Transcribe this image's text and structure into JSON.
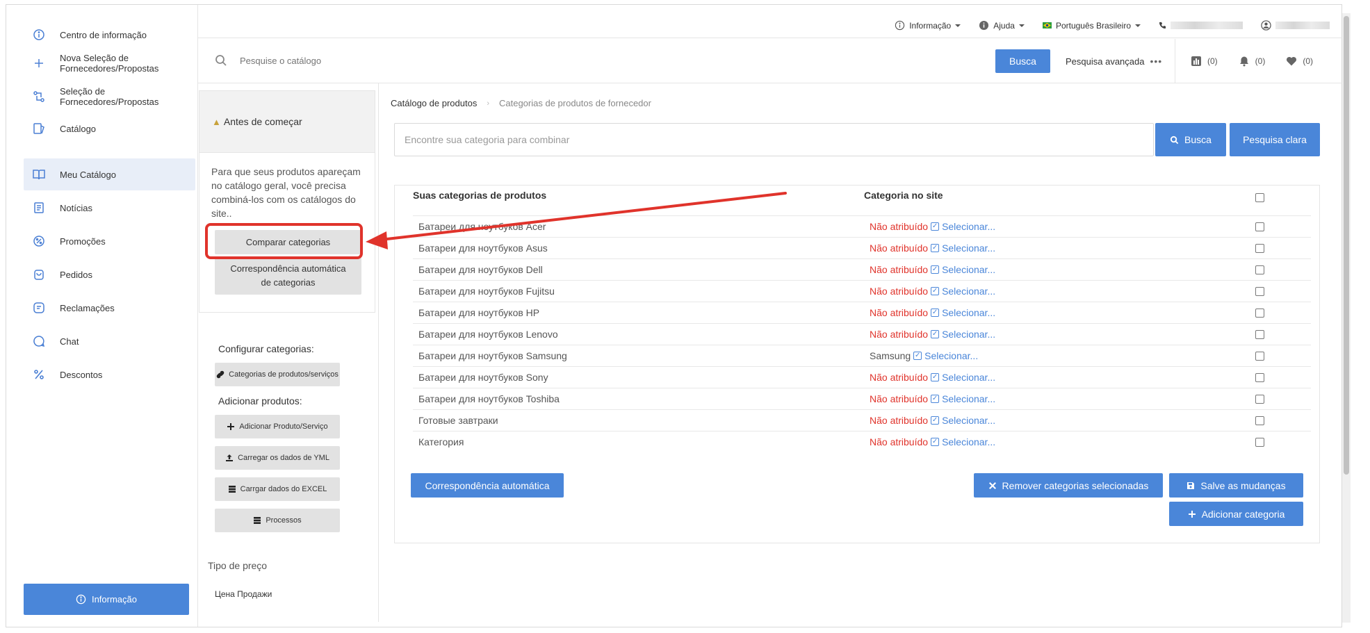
{
  "sidebar": {
    "items": [
      {
        "label": "Centro de informação",
        "icon": "info-circle-icon"
      },
      {
        "label": "Nova Seleção de Fornecedores/Propostas",
        "icon": "plus-icon"
      },
      {
        "label": "Seleção de Fornecedores/Propostas",
        "icon": "swap-icon"
      },
      {
        "label": "Catálogo",
        "icon": "catalog-icon"
      },
      {
        "label": "Meu Catálogo",
        "icon": "book-icon"
      },
      {
        "label": "Notícias",
        "icon": "news-icon"
      },
      {
        "label": "Promoções",
        "icon": "percent-badge-icon"
      },
      {
        "label": "Pedidos",
        "icon": "bag-icon"
      },
      {
        "label": "Reclamações",
        "icon": "complaint-icon"
      },
      {
        "label": "Chat",
        "icon": "chat-icon"
      },
      {
        "label": "Descontos",
        "icon": "percent-icon"
      }
    ],
    "active_index": 4,
    "info_button": "Informação"
  },
  "topbar": {
    "info": "Informação",
    "help": "Ajuda",
    "language": "Português Brasileiro"
  },
  "search": {
    "placeholder": "Pesquise o catálogo",
    "button": "Busca",
    "advanced": "Pesquisa avançada",
    "counters": [
      "(0)",
      "(0)",
      "(0)"
    ]
  },
  "left_panel": {
    "before_title": "Antes de começar",
    "before_text": "Para que seus produtos apareçam no catálogo geral, você precisa combiná-los com os catálogos do site..",
    "compare_button": "Comparar categorias",
    "auto_match_button": "Correspondência automática de categorias",
    "configure_label": "Configurar categorias:",
    "categories_button": "Categorias de produtos/serviços",
    "add_products_label": "Adicionar produtos:",
    "add_product_button": "Adicionar Produto/Serviço",
    "yml_button": "Carregar os dados de YML",
    "excel_button": "Carrgar dados do EXCEL",
    "processes_button": "Processos",
    "price_type_label": "Tipo de preço",
    "price_type_value": "Цена Продажи"
  },
  "main": {
    "breadcrumb": [
      "Catálogo de produtos",
      "Categorias de produtos de fornecedor"
    ],
    "category_search_placeholder": "Encontre sua categoria para combinar",
    "search_button": "Busca",
    "clear_button": "Pesquisa clara",
    "columns": [
      "Suas categorias de produtos",
      "Categoria no site"
    ],
    "not_assigned": "Não atribuído",
    "select": "Selecionar...",
    "rows": [
      {
        "name": "Батареи для ноутбуков Acer",
        "site": "Não atribuído"
      },
      {
        "name": "Батареи для ноутбуков Asus",
        "site": "Não atribuído"
      },
      {
        "name": "Батареи для ноутбуков Dell",
        "site": "Não atribuído"
      },
      {
        "name": "Батареи для ноутбуков Fujitsu",
        "site": "Não atribuído"
      },
      {
        "name": "Батареи для ноутбуков HP",
        "site": "Não atribuído"
      },
      {
        "name": "Батареи для ноутбуков Lenovo",
        "site": "Não atribuído"
      },
      {
        "name": "Батареи для ноутбуков Samsung",
        "site": "Samsung"
      },
      {
        "name": "Батареи для ноутбуков Sony",
        "site": "Não atribuído"
      },
      {
        "name": "Батареи для ноутбуков Toshiba",
        "site": "Não atribuído"
      },
      {
        "name": "Готовые завтраки",
        "site": "Não atribuído"
      },
      {
        "name": "Категория",
        "site": "Não atribuído"
      }
    ],
    "auto_match_button": "Correspondência automática",
    "remove_button": "Remover categorias selecionadas",
    "save_button": "Salve as mudanças",
    "add_category_button": "Adicionar categoria"
  },
  "colors": {
    "accent": "#4a86d9",
    "danger": "#e0332b",
    "active_bg": "#e8eef8"
  }
}
